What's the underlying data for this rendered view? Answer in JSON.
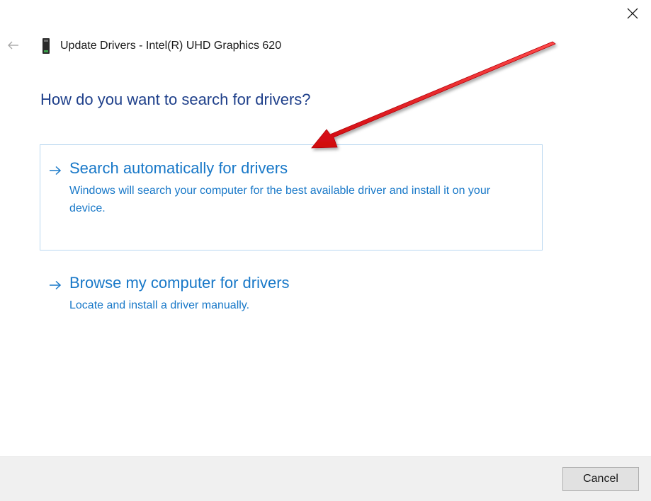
{
  "header": {
    "title": "Update Drivers - Intel(R) UHD Graphics 620",
    "back_icon": "back-arrow-icon",
    "device_icon": "display-adapter-icon",
    "close_icon": "close-icon"
  },
  "main": {
    "heading": "How do you want to search for drivers?",
    "options": [
      {
        "title": "Search automatically for drivers",
        "description": "Windows will search your computer for the best available driver and install it on your device.",
        "icon": "right-arrow-icon"
      },
      {
        "title": "Browse my computer for drivers",
        "description": "Locate and install a driver manually.",
        "icon": "right-arrow-icon"
      }
    ]
  },
  "footer": {
    "cancel_label": "Cancel"
  },
  "colors": {
    "heading": "#1e3f8a",
    "link": "#1878c8",
    "selected_border": "#b9d7f0",
    "annotation_arrow": "#e8141b",
    "footer_bg": "#f0f0f0"
  }
}
